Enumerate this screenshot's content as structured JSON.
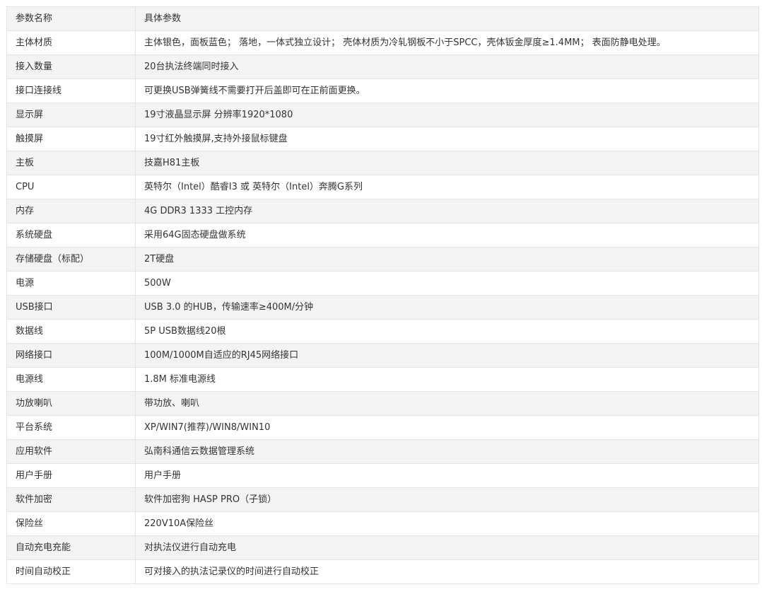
{
  "table": {
    "rows": [
      {
        "name": "参数名称",
        "value": "具体参数"
      },
      {
        "name": "主体材质",
        "value": "主体银色，面板蓝色； 落地，一体式独立设计； 壳体材质为冷轧钢板不小于SPCC，壳体钣金厚度≥1.4MM； 表面防静电处理。"
      },
      {
        "name": "接入数量",
        "value": "20台执法终端同时接入"
      },
      {
        "name": "接口连接线",
        "value": "可更换USB弹簧线不需要打开后盖即可在正前面更换。"
      },
      {
        "name": "显示屏",
        "value": "19寸液晶显示屏  分辨率1920*1080"
      },
      {
        "name": "触摸屏",
        "value": "19寸红外触摸屏,支持外接鼠标键盘"
      },
      {
        "name": "主板",
        "value": "技嘉H81主板"
      },
      {
        "name": "CPU",
        "value": "英特尔（Intel）酷睿I3 或 英特尔（Intel）奔腾G系列"
      },
      {
        "name": "内存",
        "value": "4G DDR3 1333 工控内存"
      },
      {
        "name": "系统硬盘",
        "value": "采用64G固态硬盘做系统"
      },
      {
        "name": "存储硬盘（标配）",
        "value": "2T硬盘"
      },
      {
        "name": "电源",
        "value": "500W"
      },
      {
        "name": "USB接口",
        "value": "USB 3.0 的HUB，传输速率≥400M/分钟"
      },
      {
        "name": "数据线",
        "value": "5P USB数据线20根"
      },
      {
        "name": "网络接口",
        "value": "100M/1000M自适应的RJ45网络接口"
      },
      {
        "name": "电源线",
        "value": "1.8M 标准电源线"
      },
      {
        "name": "功放喇叭",
        "value": "带功放、喇叭"
      },
      {
        "name": "平台系统",
        "value": "XP/WIN7(推荐)/WIN8/WIN10"
      },
      {
        "name": "应用软件",
        "value": "弘南科通信云数据管理系统"
      },
      {
        "name": "用户手册",
        "value": "用户手册"
      },
      {
        "name": "软件加密",
        "value": "软件加密狗 HASP PRO（子锁）"
      },
      {
        "name": "保险丝",
        "value": "220V10A保险丝"
      },
      {
        "name": "自动充电充能",
        "value": "对执法仪进行自动充电"
      },
      {
        "name": "时间自动校正",
        "value": "可对接入的执法记录仪的时间进行自动校正"
      }
    ]
  }
}
